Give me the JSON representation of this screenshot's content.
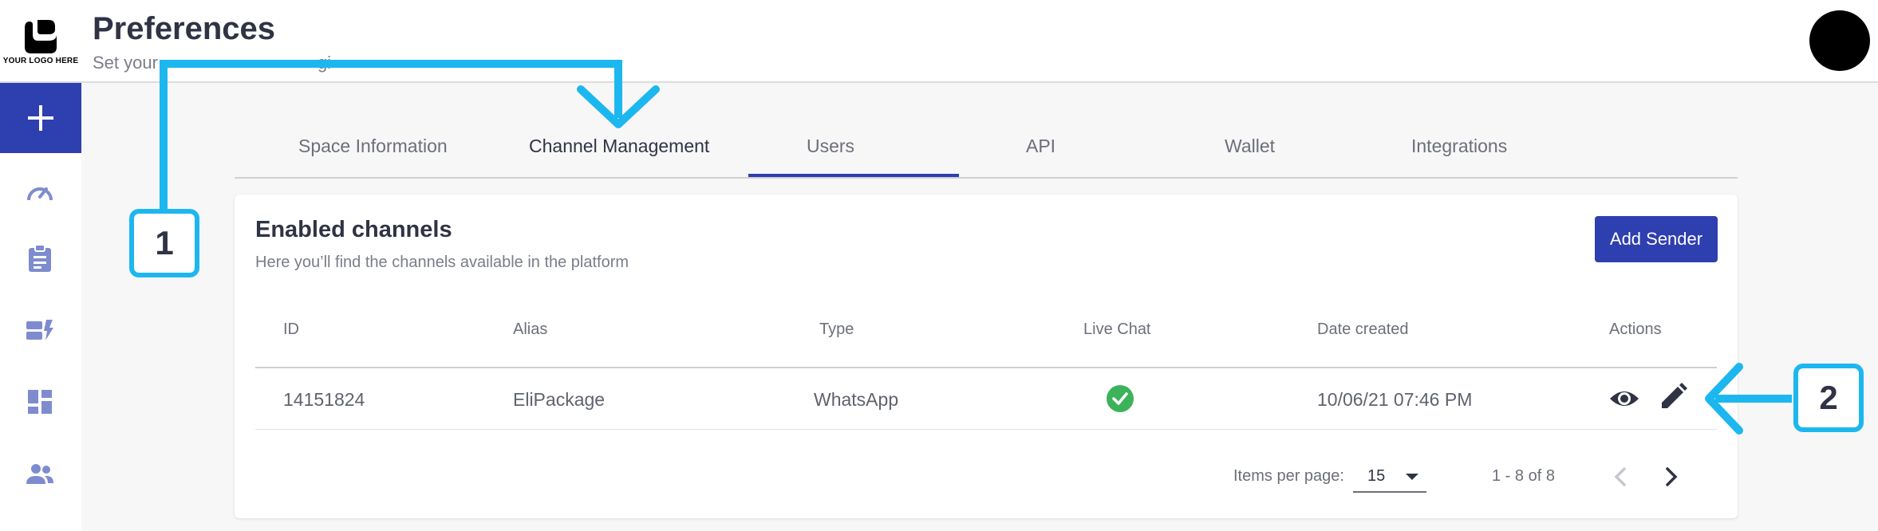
{
  "header": {
    "logo_text": "YOUR LOGO HERE",
    "title": "Preferences",
    "subtitle_visible": "Set your",
    "subtitle_tail": "gi"
  },
  "sidebar": {
    "items": [
      {
        "icon": "plus-icon"
      },
      {
        "icon": "speedometer-icon"
      },
      {
        "icon": "clipboard-icon"
      },
      {
        "icon": "campaign-icon"
      },
      {
        "icon": "dashboard-icon"
      },
      {
        "icon": "users-icon"
      }
    ]
  },
  "tabs": [
    {
      "label": "Space Information"
    },
    {
      "label": "Channel Management",
      "active": true
    },
    {
      "label": "Users"
    },
    {
      "label": "API"
    },
    {
      "label": "Wallet"
    },
    {
      "label": "Integrations"
    }
  ],
  "card": {
    "title": "Enabled channels",
    "subtitle": "Here you’ll find the channels available in the platform",
    "add_button": "Add Sender"
  },
  "table": {
    "headers": [
      "ID",
      "Alias",
      "Type",
      "Live Chat",
      "Date created",
      "Actions"
    ],
    "rows": [
      {
        "id": "14151824",
        "alias": "EliPackage",
        "type": "WhatsApp",
        "live_chat": true,
        "date": "10/06/21 07:46 PM"
      }
    ]
  },
  "pagination": {
    "label": "Items per page:",
    "per_page": "15",
    "range": "1 - 8 of 8"
  },
  "annotations": {
    "callout_1": "1",
    "callout_2": "2",
    "color": "#1db7f0"
  },
  "colors": {
    "accent": "#2e3fb0",
    "success": "#3db25a"
  }
}
